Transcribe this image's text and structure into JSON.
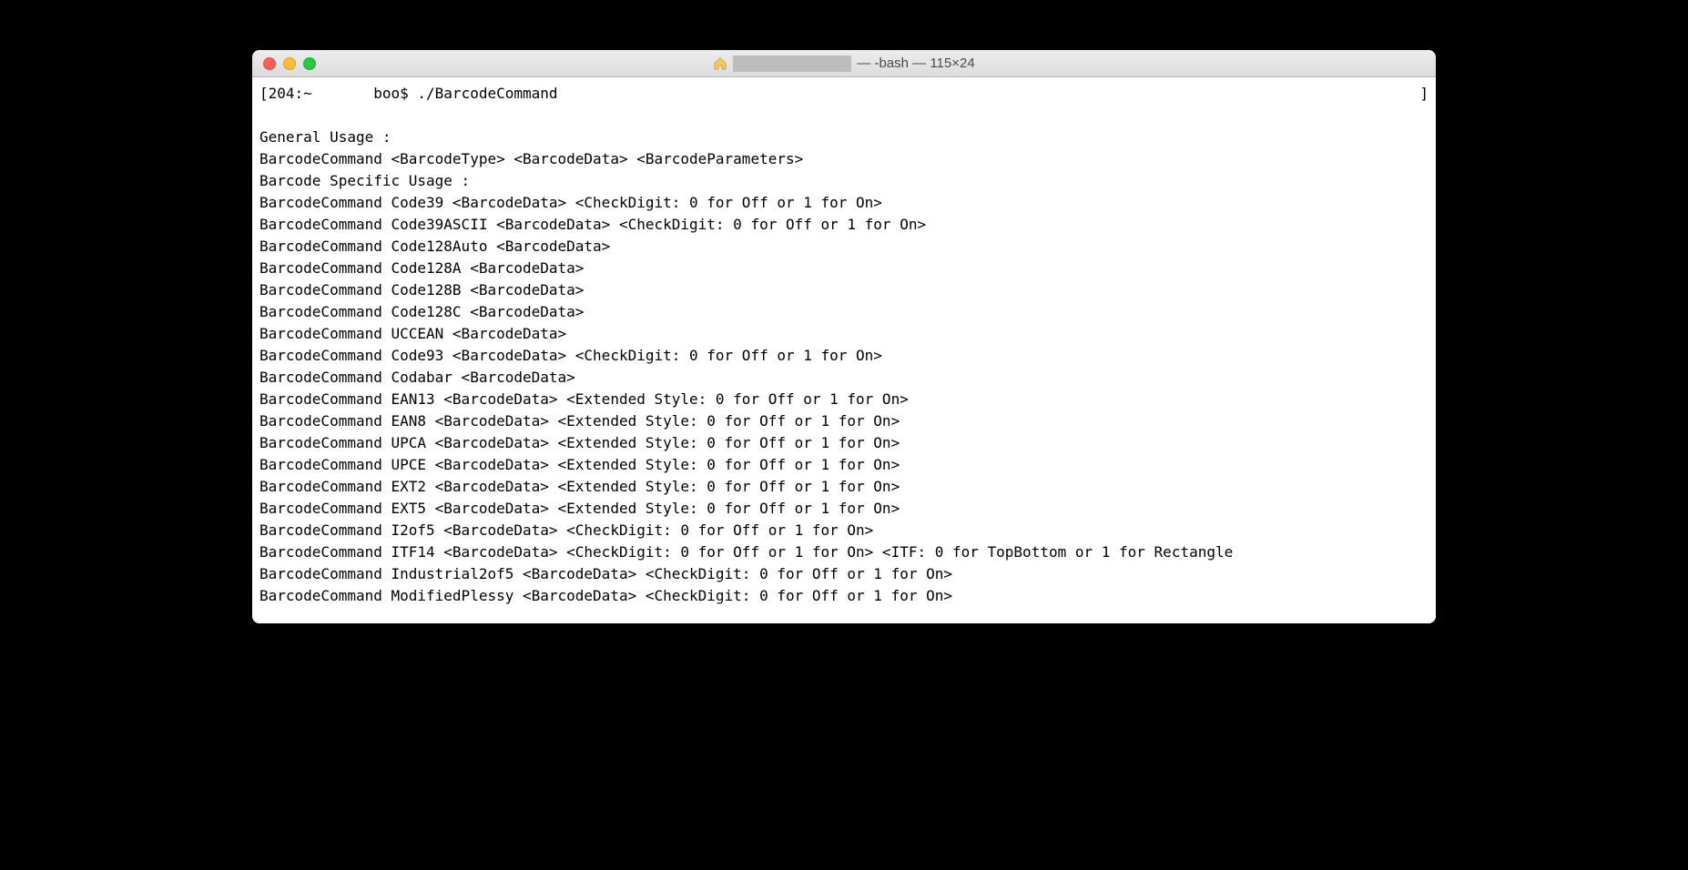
{
  "window": {
    "title_suffix": " — -bash — 115×24"
  },
  "prompt": {
    "left_bracket": "[",
    "text": "204:~       boo$ ./BarcodeCommand",
    "right_bracket": "]"
  },
  "output_lines": [
    "",
    "General Usage :",
    "BarcodeCommand <BarcodeType> <BarcodeData> <BarcodeParameters>",
    "Barcode Specific Usage :",
    "BarcodeCommand Code39 <BarcodeData> <CheckDigit: 0 for Off or 1 for On>",
    "BarcodeCommand Code39ASCII <BarcodeData> <CheckDigit: 0 for Off or 1 for On>",
    "BarcodeCommand Code128Auto <BarcodeData>",
    "BarcodeCommand Code128A <BarcodeData>",
    "BarcodeCommand Code128B <BarcodeData>",
    "BarcodeCommand Code128C <BarcodeData>",
    "BarcodeCommand UCCEAN <BarcodeData>",
    "BarcodeCommand Code93 <BarcodeData> <CheckDigit: 0 for Off or 1 for On>",
    "BarcodeCommand Codabar <BarcodeData>",
    "BarcodeCommand EAN13 <BarcodeData> <Extended Style: 0 for Off or 1 for On>",
    "BarcodeCommand EAN8 <BarcodeData> <Extended Style: 0 for Off or 1 for On>",
    "BarcodeCommand UPCA <BarcodeData> <Extended Style: 0 for Off or 1 for On>",
    "BarcodeCommand UPCE <BarcodeData> <Extended Style: 0 for Off or 1 for On>",
    "BarcodeCommand EXT2 <BarcodeData> <Extended Style: 0 for Off or 1 for On>",
    "BarcodeCommand EXT5 <BarcodeData> <Extended Style: 0 for Off or 1 for On>",
    "BarcodeCommand I2of5 <BarcodeData> <CheckDigit: 0 for Off or 1 for On>",
    "BarcodeCommand ITF14 <BarcodeData> <CheckDigit: 0 for Off or 1 for On> <ITF: 0 for TopBottom or 1 for Rectangle",
    "BarcodeCommand Industrial2of5 <BarcodeData> <CheckDigit: 0 for Off or 1 for On>",
    "BarcodeCommand ModifiedPlessy <BarcodeData> <CheckDigit: 0 for Off or 1 for On>"
  ]
}
